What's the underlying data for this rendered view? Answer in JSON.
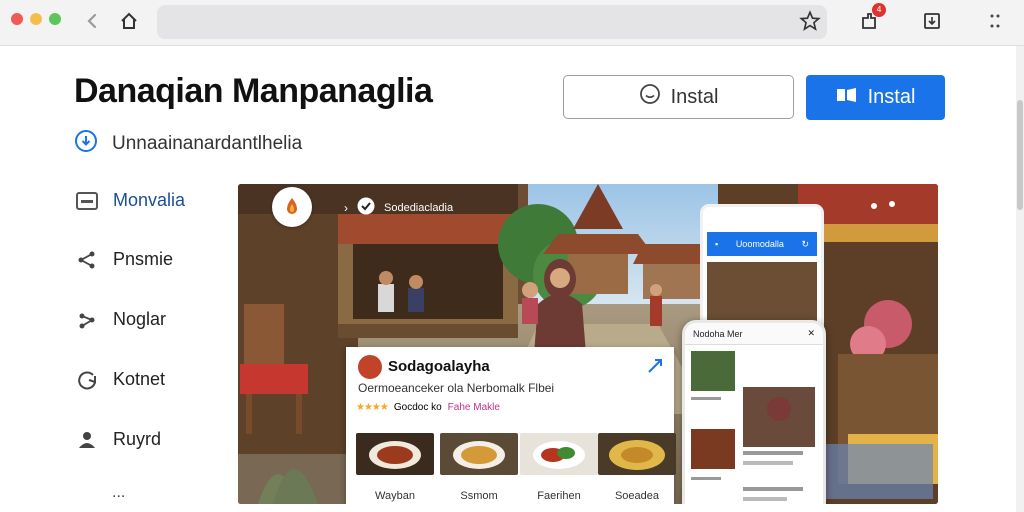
{
  "browser": {
    "notification_count": "4"
  },
  "header": {
    "title": "Danaqian Manpanaglia",
    "subtitle": "Unnaainanardantlhelia",
    "install_outline_label": "Instal",
    "install_primary_label": "Instal"
  },
  "sidebar": {
    "items": [
      {
        "label": "Monvalia",
        "icon": "window-icon"
      },
      {
        "label": "Pnsmie",
        "icon": "share-icon"
      },
      {
        "label": "Noglar",
        "icon": "share-nodes-icon"
      },
      {
        "label": "Kotnet",
        "icon": "refresh-icon"
      },
      {
        "label": "Ruyrd",
        "icon": "person-icon"
      }
    ],
    "more": "..."
  },
  "hero": {
    "caption": "Sodediacladia",
    "card": {
      "name": "Sodagoalayha",
      "description": "Oermoeanceker ola Nerbomalk Flbei",
      "stars": "★★★★",
      "rating_text": "Gocdoc ko",
      "tag": "Fahe Makle",
      "dishes": [
        "Wayban",
        "Ssmom",
        "Faerihen",
        "Soeadea"
      ]
    },
    "tablet_bar": "Uoomodalla",
    "phone_header": "Nodoha Mer"
  },
  "colors": {
    "accent": "#1a73e8",
    "active_nav": "#1a4f94"
  }
}
